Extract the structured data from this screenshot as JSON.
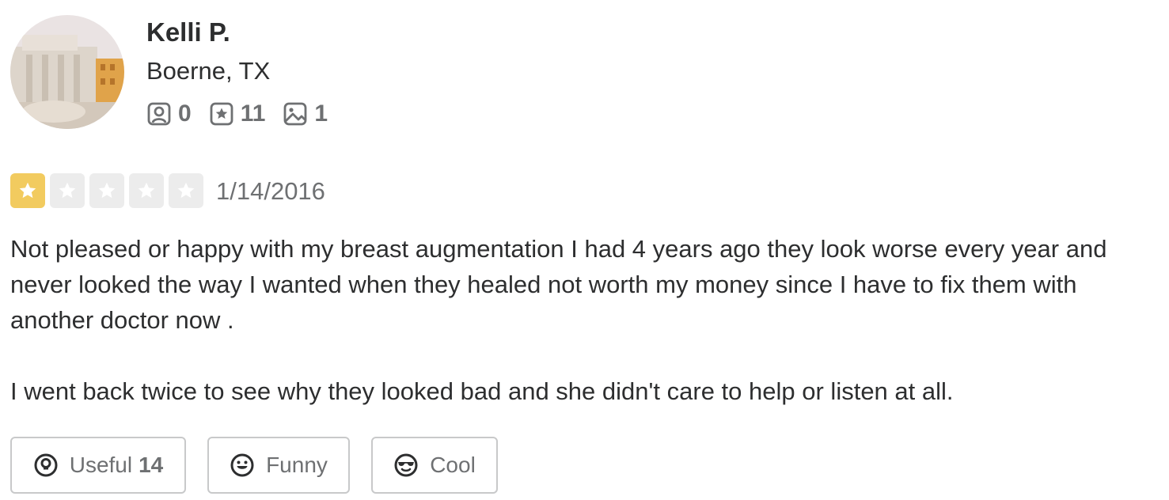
{
  "user": {
    "name": "Kelli P.",
    "location": "Boerne, TX",
    "stats": {
      "friends": "0",
      "reviews": "11",
      "photos": "1"
    }
  },
  "review": {
    "rating": 1,
    "rating_max": 5,
    "date": "1/14/2016",
    "paragraphs": [
      "Not pleased or happy with my breast augmentation I had 4 years ago they look worse every year and never looked the way I wanted when they healed not worth my money since I have to fix them with another doctor now .",
      "I went back twice to see why they looked bad and she didn't care to help or listen at all."
    ]
  },
  "reactions": {
    "useful_label": "Useful",
    "useful_count": "14",
    "funny_label": "Funny",
    "cool_label": "Cool"
  },
  "colors": {
    "star_filled": "#f2cb5f",
    "star_empty": "#ececec",
    "text": "#2d2e2f",
    "muted": "#6e7072",
    "button_border": "#c8c9ca"
  },
  "icons": {
    "friends": "user-frame-icon",
    "reviews": "star-frame-icon",
    "photos": "photo-icon",
    "useful": "lightbulb-icon",
    "funny": "laughing-face-icon",
    "cool": "sunglasses-face-icon",
    "star": "star-icon"
  }
}
